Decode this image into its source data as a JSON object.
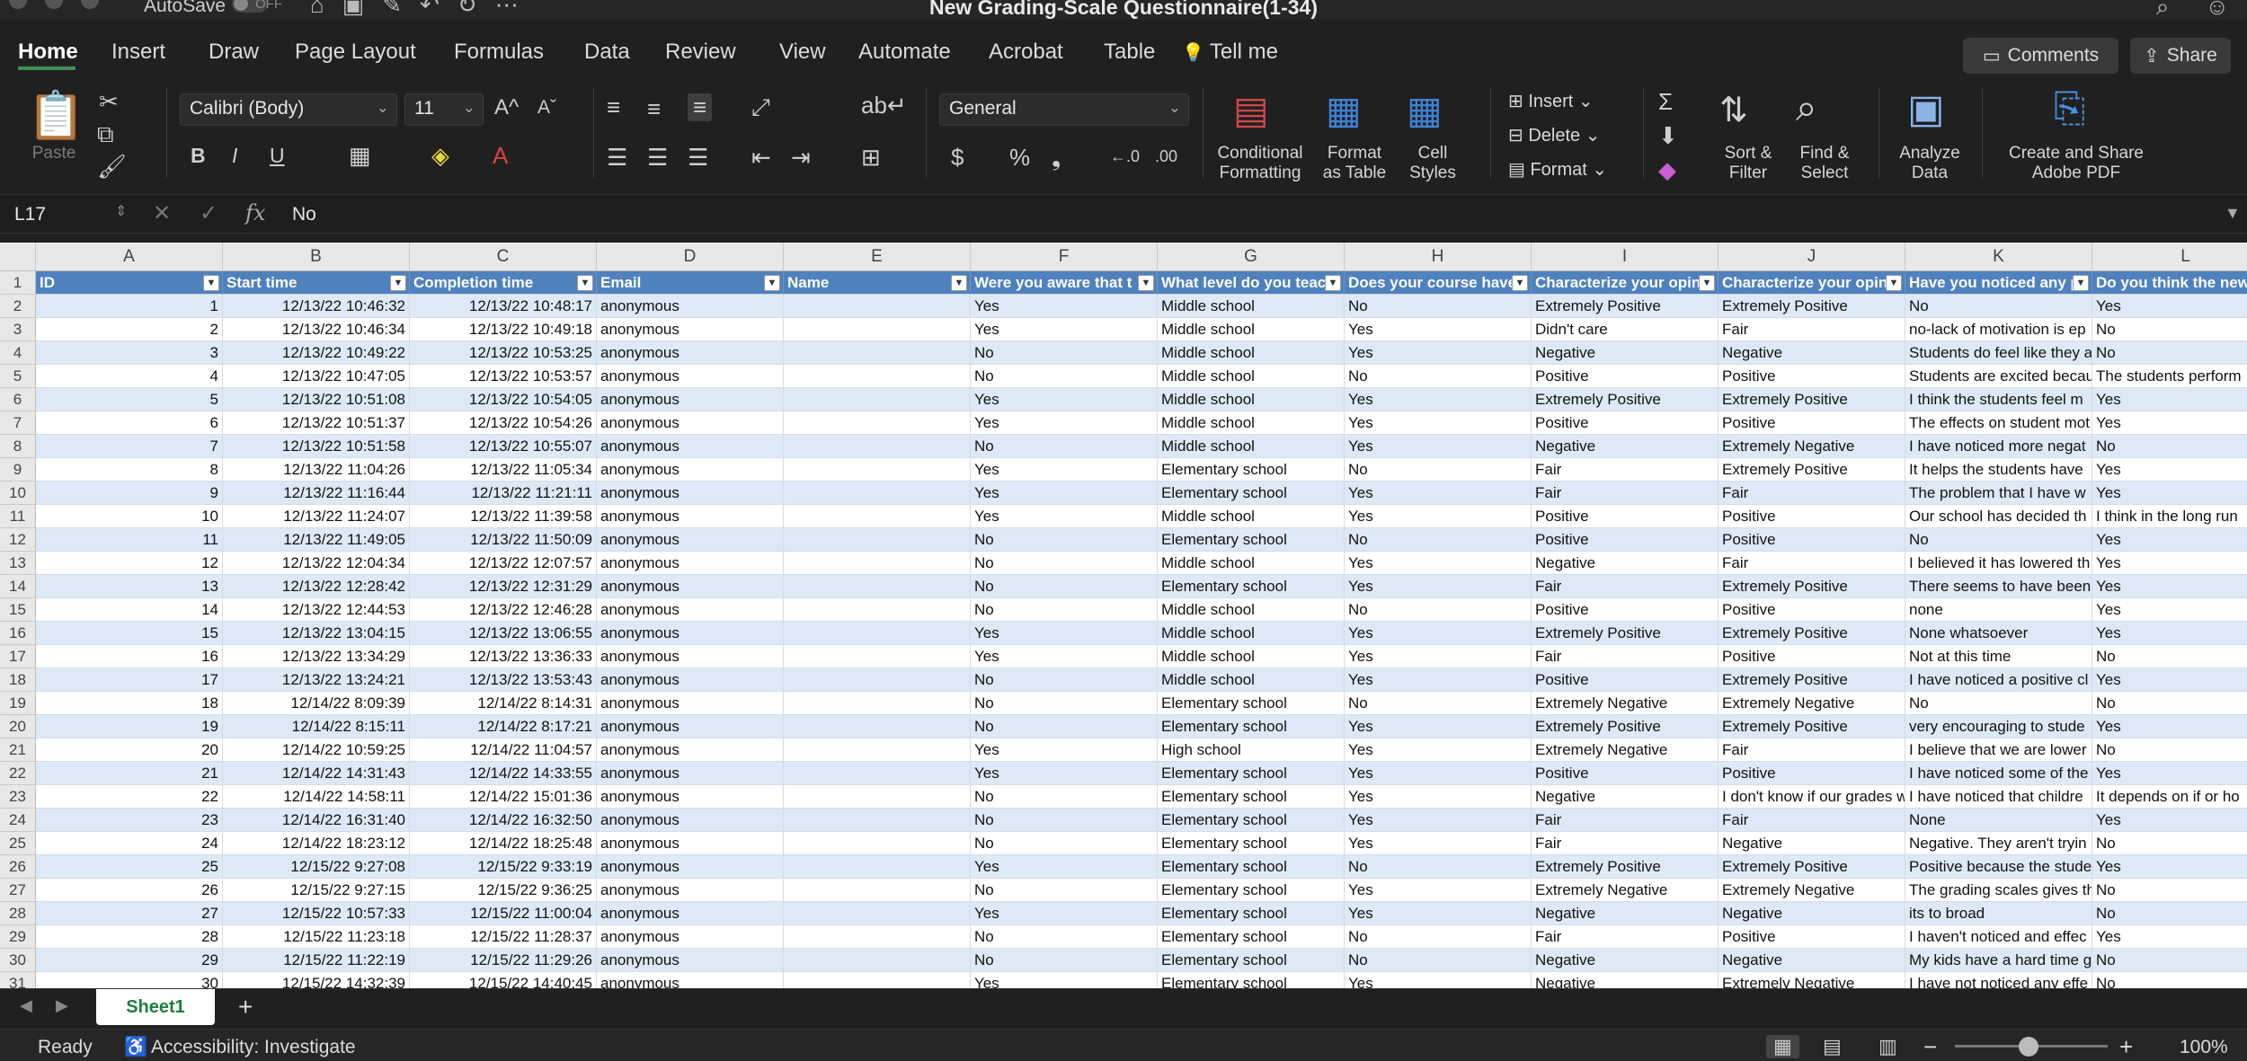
{
  "titlebar": {
    "autosave_label": "AutoSave",
    "autosave_state": "OFF",
    "document_title": "New Grading-Scale Questionnaire(1-34)"
  },
  "tabs": [
    "Home",
    "Insert",
    "Draw",
    "Page Layout",
    "Formulas",
    "Data",
    "Review",
    "View",
    "Automate",
    "Acrobat",
    "Table",
    "Tell me"
  ],
  "buttons": {
    "comments": "Comments",
    "share": "Share"
  },
  "ribbon": {
    "paste": "Paste",
    "font_name": "Calibri (Body)",
    "font_size": "11",
    "number_format": "General",
    "conditional_formatting": [
      "Conditional",
      "Formatting"
    ],
    "format_as_table": [
      "Format",
      "as Table"
    ],
    "cell_styles": [
      "Cell",
      "Styles"
    ],
    "insert": "Insert",
    "delete": "Delete",
    "format": "Format",
    "sort_filter": [
      "Sort &",
      "Filter"
    ],
    "find_select": [
      "Find &",
      "Select"
    ],
    "analyze_data": [
      "Analyze",
      "Data"
    ],
    "create_share_pdf": [
      "Create and Share",
      "Adobe PDF"
    ]
  },
  "formula_bar": {
    "cell_ref": "L17",
    "fx": "fx",
    "value": "No"
  },
  "columns": [
    "A",
    "B",
    "C",
    "D",
    "E",
    "F",
    "G",
    "H",
    "I",
    "J",
    "K",
    "L"
  ],
  "headers": [
    "ID",
    "Start time",
    "Completion time",
    "Email",
    "Name",
    "Were you aware that t",
    "What level do you teac",
    "Does your course have",
    "Characterize your opin",
    "Characterize your opin",
    "Have you noticed any p",
    "Do you think the new"
  ],
  "rows": [
    [
      "1",
      "12/13/22 10:46:32",
      "12/13/22 10:48:17",
      "anonymous",
      "",
      "Yes",
      "Middle school",
      "No",
      "Extremely Positive",
      "Extremely Positive",
      "No",
      "Yes"
    ],
    [
      "2",
      "12/13/22 10:46:34",
      "12/13/22 10:49:18",
      "anonymous",
      "",
      "Yes",
      "Middle school",
      "Yes",
      "Didn't care",
      "Fair",
      "no-lack of motivation is ep",
      "No"
    ],
    [
      "3",
      "12/13/22 10:49:22",
      "12/13/22 10:53:25",
      "anonymous",
      "",
      "No",
      "Middle school",
      "Yes",
      "Negative",
      "Negative",
      "Students do feel like they a",
      "No"
    ],
    [
      "4",
      "12/13/22 10:47:05",
      "12/13/22 10:53:57",
      "anonymous",
      "",
      "No",
      "Middle school",
      "No",
      "Positive",
      "Positive",
      "Students are excited becau",
      "The students perform"
    ],
    [
      "5",
      "12/13/22 10:51:08",
      "12/13/22 10:54:05",
      "anonymous",
      "",
      "Yes",
      "Middle school",
      "Yes",
      "Extremely Positive",
      "Extremely Positive",
      "I think the students feel m",
      "Yes"
    ],
    [
      "6",
      "12/13/22 10:51:37",
      "12/13/22 10:54:26",
      "anonymous",
      "",
      "Yes",
      "Middle school",
      "Yes",
      "Positive",
      "Positive",
      "The effects on student mot",
      "Yes"
    ],
    [
      "7",
      "12/13/22 10:51:58",
      "12/13/22 10:55:07",
      "anonymous",
      "",
      "No",
      "Middle school",
      "Yes",
      "Negative",
      "Extremely Negative",
      "I have noticed more negat",
      "No"
    ],
    [
      "8",
      "12/13/22 11:04:26",
      "12/13/22 11:05:34",
      "anonymous",
      "",
      "Yes",
      "Elementary school",
      "No",
      "Fair",
      "Extremely Positive",
      "It helps the students have",
      "Yes"
    ],
    [
      "9",
      "12/13/22 11:16:44",
      "12/13/22 11:21:11",
      "anonymous",
      "",
      "Yes",
      "Elementary school",
      "Yes",
      "Fair",
      "Fair",
      "The problem that I have w",
      "Yes"
    ],
    [
      "10",
      "12/13/22 11:24:07",
      "12/13/22 11:39:58",
      "anonymous",
      "",
      "Yes",
      "Middle school",
      "Yes",
      "Positive",
      "Positive",
      "Our school has decided th",
      "I think in the long run"
    ],
    [
      "11",
      "12/13/22 11:49:05",
      "12/13/22 11:50:09",
      "anonymous",
      "",
      "No",
      "Elementary school",
      "No",
      "Positive",
      "Positive",
      "No",
      "Yes"
    ],
    [
      "12",
      "12/13/22 12:04:34",
      "12/13/22 12:07:57",
      "anonymous",
      "",
      "No",
      "Middle school",
      "Yes",
      "Negative",
      "Fair",
      "I believed it has lowered th",
      "Yes"
    ],
    [
      "13",
      "12/13/22 12:28:42",
      "12/13/22 12:31:29",
      "anonymous",
      "",
      "No",
      "Elementary school",
      "Yes",
      "Fair",
      "Extremely Positive",
      "There seems to have been a",
      "Yes"
    ],
    [
      "14",
      "12/13/22 12:44:53",
      "12/13/22 12:46:28",
      "anonymous",
      "",
      "No",
      "Middle school",
      "No",
      "Positive",
      "Positive",
      "none",
      "Yes"
    ],
    [
      "15",
      "12/13/22 13:04:15",
      "12/13/22 13:06:55",
      "anonymous",
      "",
      "Yes",
      "Middle school",
      "Yes",
      "Extremely Positive",
      "Extremely Positive",
      "None whatsoever",
      "Yes"
    ],
    [
      "16",
      "12/13/22 13:34:29",
      "12/13/22 13:36:33",
      "anonymous",
      "",
      "Yes",
      "Middle school",
      "Yes",
      "Fair",
      "Positive",
      "Not at this time",
      "No"
    ],
    [
      "17",
      "12/13/22 13:24:21",
      "12/13/22 13:53:43",
      "anonymous",
      "",
      "No",
      "Middle school",
      "Yes",
      "Positive",
      "Extremely Positive",
      "I have noticed a positive cl",
      "Yes"
    ],
    [
      "18",
      "12/14/22 8:09:39",
      "12/14/22 8:14:31",
      "anonymous",
      "",
      "No",
      "Elementary school",
      "No",
      "Extremely Negative",
      "Extremely Negative",
      "No",
      "No"
    ],
    [
      "19",
      "12/14/22 8:15:11",
      "12/14/22 8:17:21",
      "anonymous",
      "",
      "No",
      "Elementary school",
      "Yes",
      "Extremely Positive",
      "Extremely Positive",
      "very encouraging to stude",
      "Yes"
    ],
    [
      "20",
      "12/14/22 10:59:25",
      "12/14/22 11:04:57",
      "anonymous",
      "",
      "Yes",
      "High school",
      "Yes",
      "Extremely Negative",
      "Fair",
      "I believe that we are lower",
      "No"
    ],
    [
      "21",
      "12/14/22 14:31:43",
      "12/14/22 14:33:55",
      "anonymous",
      "",
      "Yes",
      "Elementary school",
      "Yes",
      "Positive",
      "Positive",
      "I have noticed some of the",
      "Yes"
    ],
    [
      "22",
      "12/14/22 14:58:11",
      "12/14/22 15:01:36",
      "anonymous",
      "",
      "No",
      "Elementary school",
      "Yes",
      "Negative",
      "I don't know if our grades w",
      "I have noticed that childre",
      "It depends on if or ho"
    ],
    [
      "23",
      "12/14/22 16:31:40",
      "12/14/22 16:32:50",
      "anonymous",
      "",
      "No",
      "Elementary school",
      "Yes",
      "Fair",
      "Fair",
      "None",
      "Yes"
    ],
    [
      "24",
      "12/14/22 18:23:12",
      "12/14/22 18:25:48",
      "anonymous",
      "",
      "No",
      "Elementary school",
      "Yes",
      "Fair",
      "Negative",
      "Negative.  They aren't tryin",
      "No"
    ],
    [
      "25",
      "12/15/22 9:27:08",
      "12/15/22 9:33:19",
      "anonymous",
      "",
      "Yes",
      "Elementary school",
      "No",
      "Extremely Positive",
      "Extremely Positive",
      "Positive because the stude",
      "Yes"
    ],
    [
      "26",
      "12/15/22 9:27:15",
      "12/15/22 9:36:25",
      "anonymous",
      "",
      "No",
      "Elementary school",
      "Yes",
      "Extremely Negative",
      "Extremely Negative",
      "The grading scales gives th",
      "No"
    ],
    [
      "27",
      "12/15/22 10:57:33",
      "12/15/22 11:00:04",
      "anonymous",
      "",
      "Yes",
      "Elementary school",
      "Yes",
      "Negative",
      "Negative",
      "its to broad",
      "No"
    ],
    [
      "28",
      "12/15/22 11:23:18",
      "12/15/22 11:28:37",
      "anonymous",
      "",
      "No",
      "Elementary school",
      "No",
      "Fair",
      "Positive",
      "I haven't noticed and effec",
      "Yes"
    ],
    [
      "29",
      "12/15/22 11:22:19",
      "12/15/22 11:29:26",
      "anonymous",
      "",
      "No",
      "Elementary school",
      "No",
      "Negative",
      "Negative",
      "My kids have a hard time g",
      "No"
    ],
    [
      "30",
      "12/15/22 14:32:39",
      "12/15/22 14:40:45",
      "anonymous",
      "",
      "Yes",
      "Elementary school",
      "Yes",
      "Negative",
      "Extremely Negative",
      "I have not noticed any effe",
      "No"
    ]
  ],
  "sheet_tab": "Sheet1",
  "status": {
    "ready": "Ready",
    "accessibility": "Accessibility: Investigate",
    "zoom": "100%"
  }
}
